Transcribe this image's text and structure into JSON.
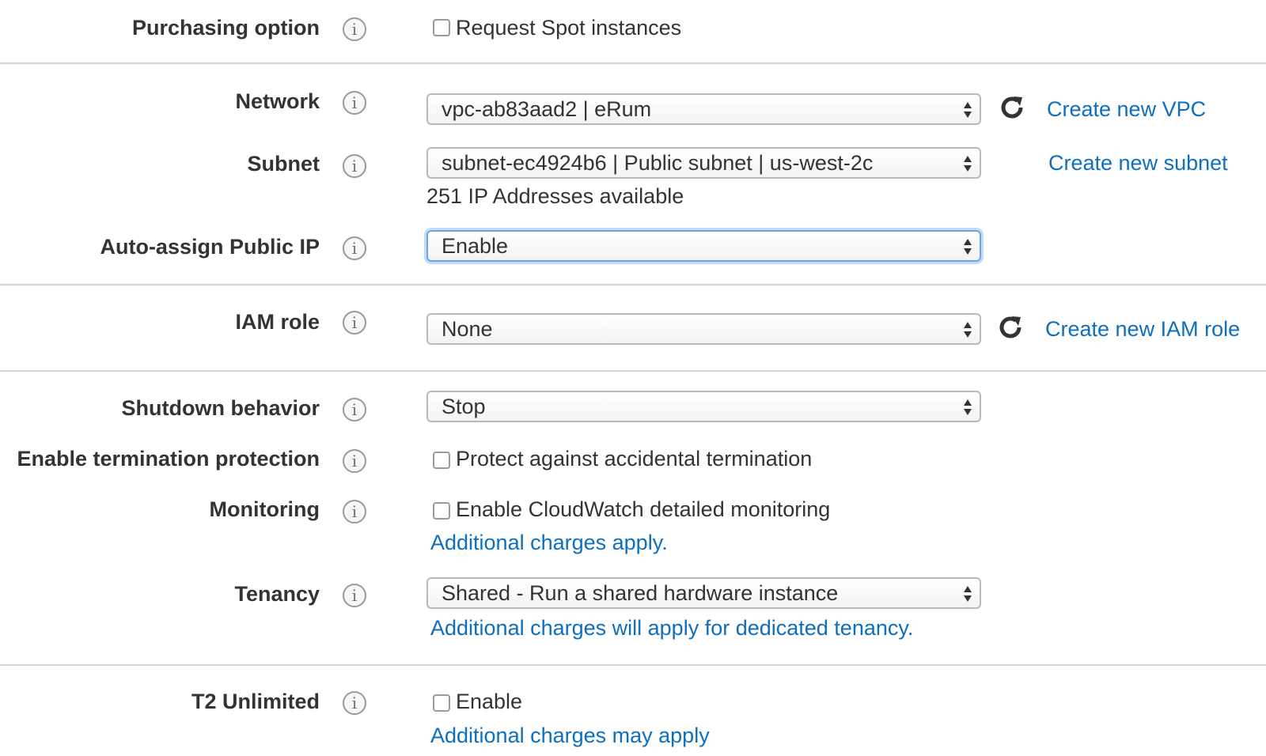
{
  "purchasing": {
    "label": "Purchasing option",
    "checkbox_label": "Request Spot instances",
    "checked": false
  },
  "network": {
    "label": "Network",
    "value": "vpc-ab83aad2 | eRum",
    "create_link": "Create new VPC"
  },
  "subnet": {
    "label": "Subnet",
    "value": "subnet-ec4924b6 | Public subnet | us-west-2c",
    "available": "251 IP Addresses available",
    "create_link": "Create new subnet"
  },
  "auto_ip": {
    "label": "Auto-assign Public IP",
    "value": "Enable"
  },
  "iam": {
    "label": "IAM role",
    "value": "None",
    "create_link": "Create new IAM role"
  },
  "shutdown": {
    "label": "Shutdown behavior",
    "value": "Stop"
  },
  "termination": {
    "label": "Enable termination protection",
    "checkbox_label": "Protect against accidental termination",
    "checked": false
  },
  "monitoring": {
    "label": "Monitoring",
    "checkbox_label": "Enable CloudWatch detailed monitoring",
    "checked": false,
    "note_link": "Additional charges apply."
  },
  "tenancy": {
    "label": "Tenancy",
    "value": "Shared - Run a shared hardware instance",
    "note_link": "Additional charges will apply for dedicated tenancy."
  },
  "t2": {
    "label": "T2 Unlimited",
    "checkbox_label": "Enable",
    "checked": false,
    "note_link": "Additional charges may apply"
  },
  "colors": {
    "link": "#0d6fbf",
    "focus": "#6aa6e4",
    "text": "#333333",
    "divider": "#d4d4d4"
  },
  "icons": {
    "info": "info-icon",
    "refresh": "refresh-icon",
    "select_arrows": "select-arrows-icon"
  }
}
